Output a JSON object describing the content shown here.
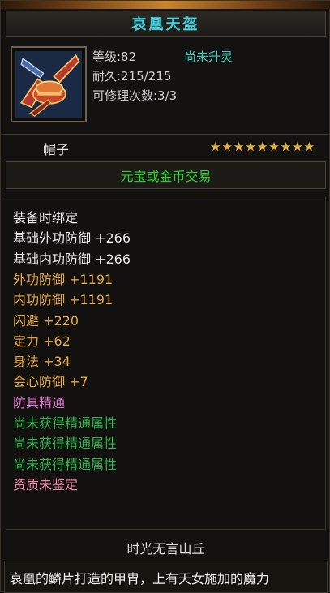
{
  "item": {
    "name": "哀凰天盔",
    "level_line": "等级:82",
    "spirit_status": "尚未升灵",
    "durability_line": "耐久:215/215",
    "repair_line": "可修理次数:3/3",
    "slot": "帽子",
    "star_count": 9,
    "star_glyph": "★",
    "trade": "元宝或金币交易",
    "attributes": [
      {
        "text": "装备时绑定",
        "color": "white"
      },
      {
        "text": "基础外功防御 +266",
        "color": "white"
      },
      {
        "text": "基础内功防御 +266",
        "color": "white"
      },
      {
        "text": "外功防御 +1191",
        "color": "orange"
      },
      {
        "text": "内功防御 +1191",
        "color": "orange"
      },
      {
        "text": "闪避 +220",
        "color": "orange"
      },
      {
        "text": "定力 +62",
        "color": "orange"
      },
      {
        "text": "身法 +34",
        "color": "orange"
      },
      {
        "text": "会心防御 +7",
        "color": "orange"
      },
      {
        "text": "防具精通",
        "color": "pink"
      },
      {
        "text": "尚未获得精通属性",
        "color": "green"
      },
      {
        "text": "尚未获得精通属性",
        "color": "green"
      },
      {
        "text": "尚未获得精通属性",
        "color": "green"
      },
      {
        "text": "资质未鉴定",
        "color": "rose"
      }
    ],
    "location": "时光无言山丘",
    "description": "哀凰的鳞片打造的甲胄，上有天女施加的魔力"
  },
  "colors": {
    "title": "#45d0de",
    "spirit": "#2ed3c4",
    "trade": "#25d42a",
    "white": "#ececec",
    "orange": "#e8a93a",
    "pink": "#e47ad6",
    "green": "#2fb54d",
    "rose": "#f08aa8",
    "star": "#e0b43a"
  },
  "icons": {
    "item_icon": "helmet-icon",
    "star": "star-icon"
  }
}
